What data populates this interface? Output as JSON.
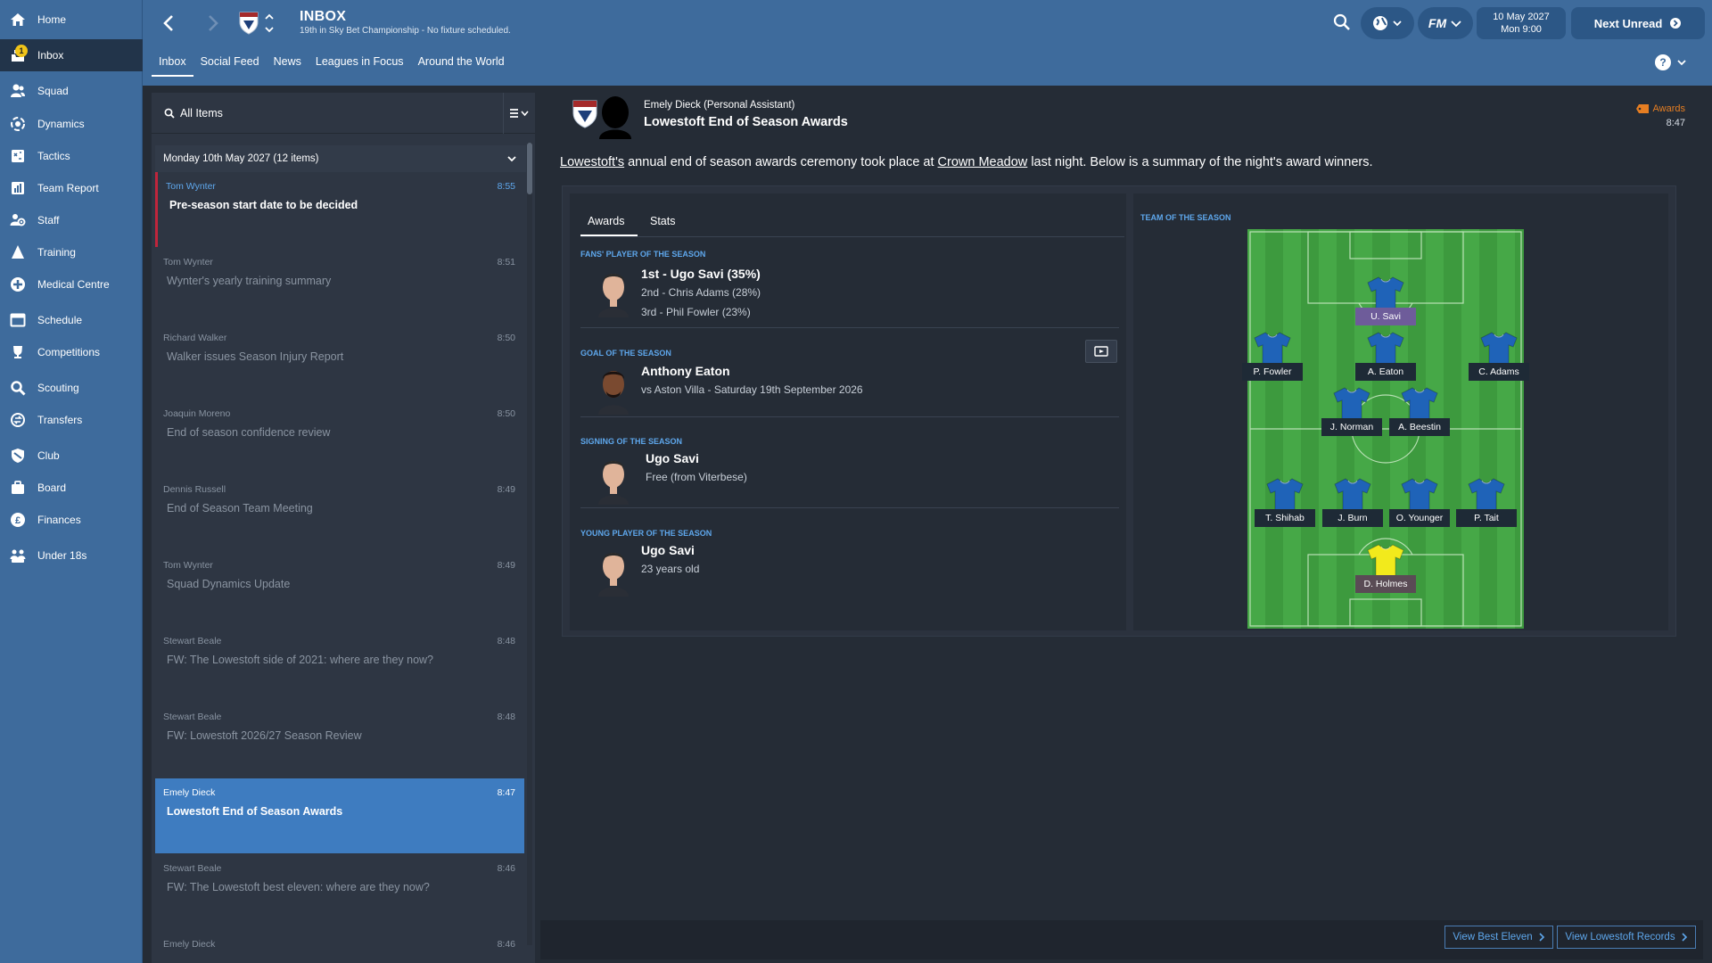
{
  "sidebar": {
    "items": [
      {
        "label": "Home",
        "icon": "home-icon"
      },
      {
        "label": "Inbox",
        "icon": "inbox-icon",
        "badge": "1",
        "active": true
      },
      {
        "label": "Squad",
        "icon": "squad-icon"
      },
      {
        "label": "Dynamics",
        "icon": "dynamics-icon"
      },
      {
        "label": "Tactics",
        "icon": "tactics-icon"
      },
      {
        "label": "Team Report",
        "icon": "team-report-icon"
      },
      {
        "label": "Staff",
        "icon": "staff-icon"
      },
      {
        "label": "Training",
        "icon": "training-icon"
      },
      {
        "label": "Medical Centre",
        "icon": "medical-icon"
      },
      {
        "label": "Schedule",
        "icon": "schedule-icon"
      },
      {
        "label": "Competitions",
        "icon": "trophy-icon"
      },
      {
        "label": "Scouting",
        "icon": "scouting-icon"
      },
      {
        "label": "Transfers",
        "icon": "transfers-icon"
      },
      {
        "label": "Club",
        "icon": "club-icon"
      },
      {
        "label": "Board",
        "icon": "board-icon"
      },
      {
        "label": "Finances",
        "icon": "finances-icon"
      },
      {
        "label": "Under 18s",
        "icon": "under18s-icon"
      }
    ]
  },
  "header": {
    "title": "INBOX",
    "subtitle": "19th in Sky Bet Championship - No fixture scheduled.",
    "date_line1": "10 May 2027",
    "date_line2": "Mon 9:00",
    "next_unread": "Next Unread",
    "fm_label": "FM",
    "help_label": "?",
    "tabs": [
      "Inbox",
      "Social Feed",
      "News",
      "Leagues in Focus",
      "Around the World"
    ]
  },
  "list": {
    "search_label": "All Items",
    "group_label": "Monday 10th May 2027 (12 items)",
    "messages": [
      {
        "sender": "Tom Wynter",
        "time": "8:55",
        "subject": "Pre-season start date to be decided"
      },
      {
        "sender": "Tom Wynter",
        "time": "8:51",
        "subject": "Wynter's yearly training summary"
      },
      {
        "sender": "Richard Walker",
        "time": "8:50",
        "subject": "Walker issues Season Injury Report"
      },
      {
        "sender": "Joaquin Moreno",
        "time": "8:50",
        "subject": "End of season confidence review"
      },
      {
        "sender": "Dennis Russell",
        "time": "8:49",
        "subject": "End of Season Team Meeting"
      },
      {
        "sender": "Tom Wynter",
        "time": "8:49",
        "subject": "Squad Dynamics Update"
      },
      {
        "sender": "Stewart Beale",
        "time": "8:48",
        "subject": "FW: The Lowestoft side of 2021: where are they now?"
      },
      {
        "sender": "Stewart Beale",
        "time": "8:48",
        "subject": "FW: Lowestoft 2026/27 Season Review"
      },
      {
        "sender": "Emely Dieck",
        "time": "8:47",
        "subject": "Lowestoft End of Season Awards"
      },
      {
        "sender": "Stewart Beale",
        "time": "8:46",
        "subject": "FW: The Lowestoft best eleven: where are they now?"
      },
      {
        "sender": "Emely Dieck",
        "time": "8:46",
        "subject": ""
      }
    ]
  },
  "detail": {
    "sender_line": "Emely Dieck  (Personal Assistant)",
    "subject": "Lowestoft End of Season Awards",
    "tag": "Awards",
    "time": "8:47",
    "intro_club": "Lowestoft's",
    "intro_mid": " annual end of season awards ceremony took place at ",
    "intro_ground": "Crown Meadow",
    "intro_end": " last night. Below is a summary of the night's award winners.",
    "tabs": [
      "Awards",
      "Stats"
    ],
    "fans_title": "FANS' PLAYER OF THE SEASON",
    "fans_1st": "1st - Ugo Savi (35%)",
    "fans_2nd": "2nd - Chris Adams (28%)",
    "fans_3rd": "3rd - Phil Fowler (23%)",
    "goal_title": "GOAL OF THE SEASON",
    "goal_name": "Anthony Eaton",
    "goal_detail": "vs Aston Villa - Saturday 19th September 2026",
    "signing_title": "SIGNING OF THE SEASON",
    "signing_name": "Ugo Savi",
    "signing_detail": "Free (from Viterbese)",
    "young_title": "YOUNG PLAYER OF THE SEASON",
    "young_name": "Ugo Savi",
    "young_detail": "23 years old",
    "tos_title": "TEAM OF THE SEASON",
    "team": [
      {
        "name": "U. Savi",
        "pos": "ST",
        "captain": true
      },
      {
        "name": "P. Fowler",
        "pos": "AML"
      },
      {
        "name": "A. Eaton",
        "pos": "AMC"
      },
      {
        "name": "C. Adams",
        "pos": "AMR"
      },
      {
        "name": "J. Norman",
        "pos": "MC"
      },
      {
        "name": "A. Beestin",
        "pos": "MC"
      },
      {
        "name": "T. Shihab",
        "pos": "DL"
      },
      {
        "name": "J. Burn",
        "pos": "DC"
      },
      {
        "name": "O. Younger",
        "pos": "DC"
      },
      {
        "name": "P. Tait",
        "pos": "DR"
      },
      {
        "name": "D. Holmes",
        "pos": "GK",
        "goalkeeper": true
      }
    ],
    "btn_best_eleven": "View Best Eleven",
    "btn_records": "View Lowestoft Records"
  },
  "colors": {
    "sidebar": "#3e6b9c",
    "accent": "#5ea7ec",
    "selected_row": "#3e7cc0",
    "unread_marker": "#c0253c",
    "tag": "#e67e22",
    "pitch": "#3d9a3e",
    "kit": "#1f63b8",
    "gk_kit": "#f2ea1c"
  }
}
